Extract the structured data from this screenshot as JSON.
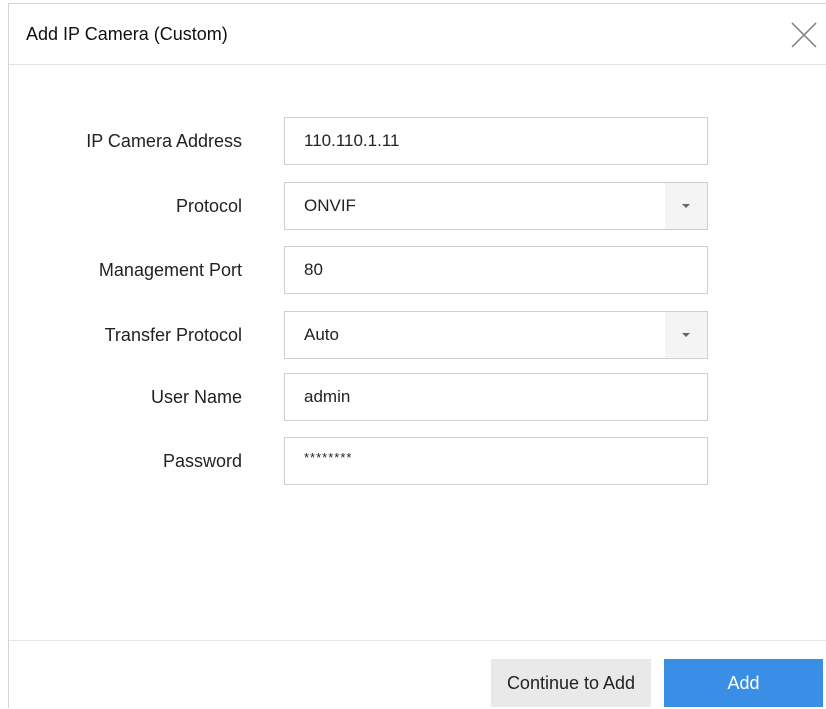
{
  "dialog": {
    "title": "Add IP Camera (Custom)"
  },
  "form": {
    "ip_address": {
      "label": "IP Camera Address",
      "value": "110.110.1.11"
    },
    "protocol": {
      "label": "Protocol",
      "value": "ONVIF"
    },
    "management_port": {
      "label": "Management Port",
      "value": "80"
    },
    "transfer_protocol": {
      "label": "Transfer Protocol",
      "value": "Auto"
    },
    "user_name": {
      "label": "User Name",
      "value": "admin"
    },
    "password": {
      "label": "Password",
      "value": "********"
    }
  },
  "footer": {
    "continue_label": "Continue to Add",
    "add_label": "Add"
  },
  "icons": {
    "close": "close-icon",
    "dropdown": "chevron-down-icon"
  },
  "colors": {
    "primary_button": "#3b8ee6",
    "secondary_button": "#e9e9e9",
    "border": "#cfcfcf"
  }
}
